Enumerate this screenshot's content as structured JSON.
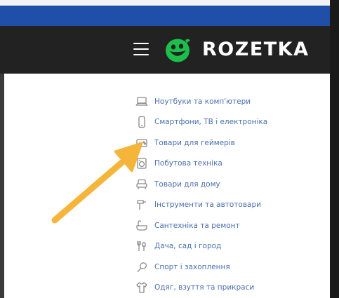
{
  "header": {
    "logo_text": "ROZETKA",
    "logo_color": "#1dbf4b",
    "background": "#222222",
    "accent_bar": "#1f4fa8"
  },
  "icons": {
    "menu": "hamburger-icon",
    "logo": "smiley-logo-icon"
  },
  "menu": {
    "items": [
      {
        "label": "Ноутбуки та комп'ютери",
        "icon": "laptop-icon"
      },
      {
        "label": "Смартфони, ТВ і електроніка",
        "icon": "smartphone-icon"
      },
      {
        "label": "Товари для геймерів",
        "icon": "gamepad-icon"
      },
      {
        "label": "Побутова техніка",
        "icon": "appliance-icon"
      },
      {
        "label": "Товари для дому",
        "icon": "armchair-icon"
      },
      {
        "label": "Інструменти та автотовари",
        "icon": "tools-icon"
      },
      {
        "label": "Сантехніка та ремонт",
        "icon": "bathtub-icon"
      },
      {
        "label": "Дача, сад і город",
        "icon": "garden-tools-icon"
      },
      {
        "label": "Спорт і захоплення",
        "icon": "sport-icon"
      },
      {
        "label": "Одяг, взуття та прикраси",
        "icon": "clothing-icon"
      }
    ]
  },
  "annotation": {
    "arrow_color": "#f5b43a",
    "points_to": "Товари для геймерів"
  }
}
